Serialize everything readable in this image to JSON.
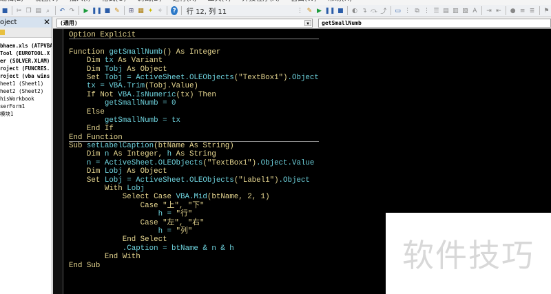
{
  "menu": [
    "编辑(E)",
    "视图(V)",
    "插入(I)",
    "格式(O)",
    "调试(D)",
    "运行(R)",
    "工具(T)",
    "外接程序(A)",
    "窗口(W)",
    "帮助(H)"
  ],
  "toolbar": {
    "position": "行 12, 列 11"
  },
  "project": {
    "title": "oject",
    "items": [
      "bhaen.xls (ATPVBA",
      "Tool (EUROTOOL.X",
      "er (SOLVER.XLAM)",
      "roject (FUNCRES.",
      "roject (vba wins",
      "heet1 (Sheet1)",
      "heet2 (Sheet2)",
      "hisWorkbook",
      "serForm1",
      "模块1"
    ]
  },
  "editor": {
    "object_combo": "(通用)",
    "proc_combo": "getSmallNumb"
  },
  "code": [
    [
      [
        "Option Explicit",
        "k"
      ]
    ],
    [],
    [
      [
        "Function ",
        "k"
      ],
      [
        "getSmallNumb",
        "i"
      ],
      [
        "() As Integer",
        "k"
      ]
    ],
    [
      [
        "    Dim ",
        "k"
      ],
      [
        "tx",
        "i"
      ],
      [
        " As Variant",
        "k"
      ]
    ],
    [
      [
        "    Dim ",
        "k"
      ],
      [
        "Tobj",
        "i"
      ],
      [
        " As Object",
        "k"
      ]
    ],
    [
      [
        "    Set ",
        "k"
      ],
      [
        "Tobj = ActiveSheet.OLEObjects",
        "i"
      ],
      [
        "(\"TextBox1\")",
        "k"
      ],
      [
        ".Object",
        "i"
      ]
    ],
    [
      [
        "    tx = VBA.Trim",
        "i"
      ],
      [
        "(Tobj.Value)",
        "k"
      ]
    ],
    [
      [
        "    If Not ",
        "k"
      ],
      [
        "VBA.IsNumeric",
        "i"
      ],
      [
        "(tx) Then",
        "k"
      ]
    ],
    [
      [
        "        getSmallNumb = 0",
        "i"
      ]
    ],
    [
      [
        "    Else",
        "k"
      ]
    ],
    [
      [
        "        getSmallNumb = tx",
        "i"
      ]
    ],
    [
      [
        "    End If",
        "k"
      ]
    ],
    [
      [
        "End Function",
        "k"
      ]
    ],
    [
      [
        "Sub ",
        "k"
      ],
      [
        "setLabelCaption",
        "i"
      ],
      [
        "(btName As String)",
        "k"
      ]
    ],
    [
      [
        "    Dim ",
        "k"
      ],
      [
        "n",
        "i"
      ],
      [
        " As Integer, ",
        "k"
      ],
      [
        "h",
        "i"
      ],
      [
        " As String",
        "k"
      ]
    ],
    [
      [
        "    n = ActiveSheet.OLEObjects",
        "i"
      ],
      [
        "(\"TextBox1\")",
        "k"
      ],
      [
        ".Object.Value",
        "i"
      ]
    ],
    [
      [
        "    Dim ",
        "k"
      ],
      [
        "Lobj",
        "i"
      ],
      [
        " As Object",
        "k"
      ]
    ],
    [
      [
        "    Set ",
        "k"
      ],
      [
        "Lobj = ActiveSheet.OLEObjects",
        "i"
      ],
      [
        "(\"Label1\")",
        "k"
      ],
      [
        ".Object",
        "i"
      ]
    ],
    [
      [
        "        With ",
        "k"
      ],
      [
        "Lobj",
        "i"
      ]
    ],
    [
      [
        "            Select Case ",
        "k"
      ],
      [
        "VBA.Mid",
        "i"
      ],
      [
        "(btName, 2, 1)",
        "k"
      ]
    ],
    [
      [
        "                Case \"上\", \"下\"",
        "k"
      ]
    ],
    [
      [
        "                    h = ",
        "i"
      ],
      [
        "\"行\"",
        "k"
      ]
    ],
    [
      [
        "                Case \"左\", \"右\"",
        "k"
      ]
    ],
    [
      [
        "                    h = ",
        "i"
      ],
      [
        "\"列\"",
        "k"
      ]
    ],
    [
      [
        "            End Select",
        "k"
      ]
    ],
    [
      [
        "            .Caption = btName & n & h",
        "i"
      ]
    ],
    [
      [
        "        End With",
        "k"
      ]
    ],
    [
      [
        "End Sub",
        "k"
      ]
    ]
  ],
  "watermark": "软件技巧"
}
